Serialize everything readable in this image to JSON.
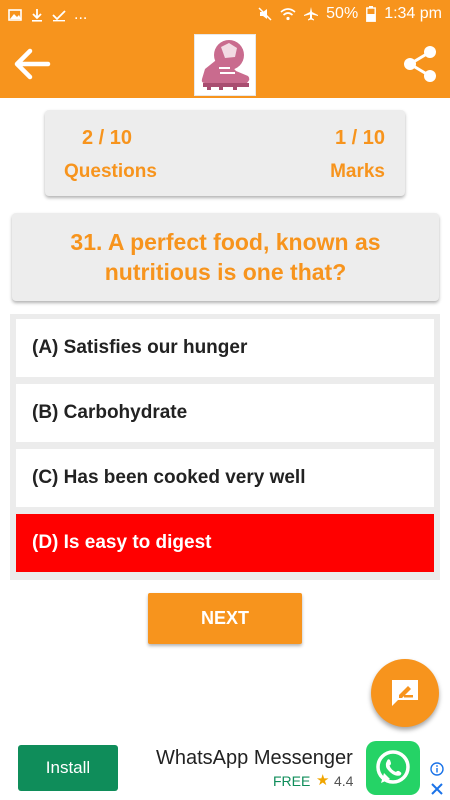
{
  "status_bar": {
    "dots": "...",
    "battery": "50%",
    "time": "1:34 pm",
    "icons_left": [
      "image-icon",
      "download-icon",
      "check-icon"
    ],
    "icons_right": [
      "mute-icon",
      "wifi-icon",
      "airplane-icon",
      "battery-icon"
    ]
  },
  "app_bar": {
    "back_icon": "arrow-left-icon",
    "logo_icon": "football-shoe-logo",
    "share_icon": "share-icon"
  },
  "score": {
    "questions_value": "2 / 10",
    "questions_label": "Questions",
    "marks_value": "1 / 10",
    "marks_label": "Marks"
  },
  "question": {
    "text": "31. A perfect food, known as nutritious is one that?"
  },
  "options": [
    {
      "label": "(A) Satisfies our hunger",
      "state": "normal"
    },
    {
      "label": "(B) Carbohydrate",
      "state": "normal"
    },
    {
      "label": "(C) Has been cooked very well",
      "state": "normal"
    },
    {
      "label": "(D) Is easy to digest",
      "state": "wrong"
    }
  ],
  "next_button": {
    "label": "NEXT"
  },
  "fab": {
    "icon": "feedback-edit-icon"
  },
  "ad": {
    "install_label": "Install",
    "app_name": "WhatsApp Messenger",
    "price": "FREE",
    "rating": "4.4",
    "star_icon": "star-icon",
    "app_icon": "whatsapp-icon",
    "info_icon": "info-icon",
    "close_icon": "close-icon"
  },
  "colors": {
    "accent": "#f7941d",
    "wrong": "#ff0000",
    "install": "#0f8d5a",
    "whatsapp": "#25d366"
  }
}
